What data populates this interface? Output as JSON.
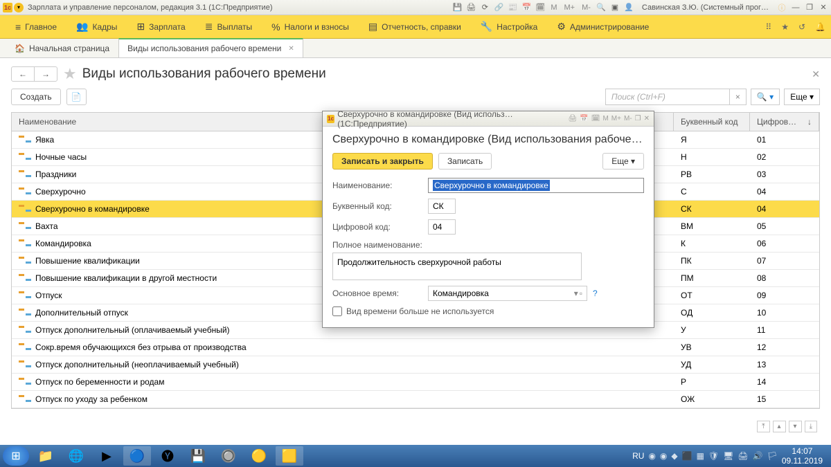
{
  "titlebar": {
    "app_title": "Зарплата и управление персоналом, редакция 3.1  (1С:Предприятие)",
    "user_label": "Савинская З.Ю. (Системный прог…",
    "m": "M",
    "m_plus": "M+",
    "m_minus": "M-"
  },
  "menu": {
    "items": [
      {
        "icon": "≡",
        "label": "Главное"
      },
      {
        "icon": "👥",
        "label": "Кадры"
      },
      {
        "icon": "⊞",
        "label": "Зарплата"
      },
      {
        "icon": "≣",
        "label": "Выплаты"
      },
      {
        "icon": "%",
        "label": "Налоги и взносы"
      },
      {
        "icon": "▤",
        "label": "Отчетность, справки"
      },
      {
        "icon": "🔧",
        "label": "Настройка"
      },
      {
        "icon": "⚙",
        "label": "Администрирование"
      }
    ]
  },
  "tabs": {
    "home_icon": "🏠",
    "home_label": "Начальная страница",
    "active_label": "Виды использования рабочего времени"
  },
  "page": {
    "title": "Виды использования рабочего времени",
    "create_label": "Создать",
    "search_placeholder": "Поиск (Ctrl+F)",
    "more_label": "Еще"
  },
  "grid": {
    "col_name": "Наименование",
    "col_code": "Буквенный код",
    "col_num": "Цифров…",
    "rows": [
      {
        "name": "Явка",
        "code": "Я",
        "num": "01"
      },
      {
        "name": "Ночные часы",
        "code": "Н",
        "num": "02"
      },
      {
        "name": "Праздники",
        "code": "РВ",
        "num": "03"
      },
      {
        "name": "Сверхурочно",
        "code": "С",
        "num": "04"
      },
      {
        "name": "Сверхурочно в командировке",
        "code": "СК",
        "num": "04"
      },
      {
        "name": "Вахта",
        "code": "ВМ",
        "num": "05"
      },
      {
        "name": "Командировка",
        "code": "К",
        "num": "06"
      },
      {
        "name": "Повышение квалификации",
        "code": "ПК",
        "num": "07"
      },
      {
        "name": "Повышение квалификации в другой местности",
        "code": "ПМ",
        "num": "08"
      },
      {
        "name": "Отпуск",
        "code": "ОТ",
        "num": "09"
      },
      {
        "name": "Дополнительный отпуск",
        "code": "ОД",
        "num": "10"
      },
      {
        "name": "Отпуск дополнительный (оплачиваемый учебный)",
        "code": "У",
        "num": "11"
      },
      {
        "name": "Сокр.время обучающихся без отрыва от производства",
        "code": "УВ",
        "num": "12"
      },
      {
        "name": "Отпуск дополнительный (неоплачиваемый учебный)",
        "code": "УД",
        "num": "13"
      },
      {
        "name": "Отпуск по беременности и родам",
        "code": "Р",
        "num": "14"
      },
      {
        "name": "Отпуск по уходу за ребенком",
        "code": "ОЖ",
        "num": "15"
      }
    ]
  },
  "modal": {
    "window_title": "Сверхурочно в командировке (Вид использ…  (1С:Предприятие)",
    "heading": "Сверхурочно в командировке (Вид использования рабоче…",
    "save_close": "Записать и закрыть",
    "save": "Записать",
    "more": "Еще",
    "label_name": "Наименование:",
    "value_name": "Сверхурочно в командировке",
    "label_code": "Буквенный код:",
    "value_code": "СК",
    "label_num": "Цифровой код:",
    "value_num": "04",
    "label_full": "Полное наименование:",
    "value_full": "Продолжительность сверхурочной работы",
    "label_main": "Основное время:",
    "value_main": "Командировка",
    "checkbox_label": "Вид времени больше не используется"
  },
  "taskbar": {
    "lang": "RU",
    "time": "14:07",
    "date": "09.11.2019"
  }
}
